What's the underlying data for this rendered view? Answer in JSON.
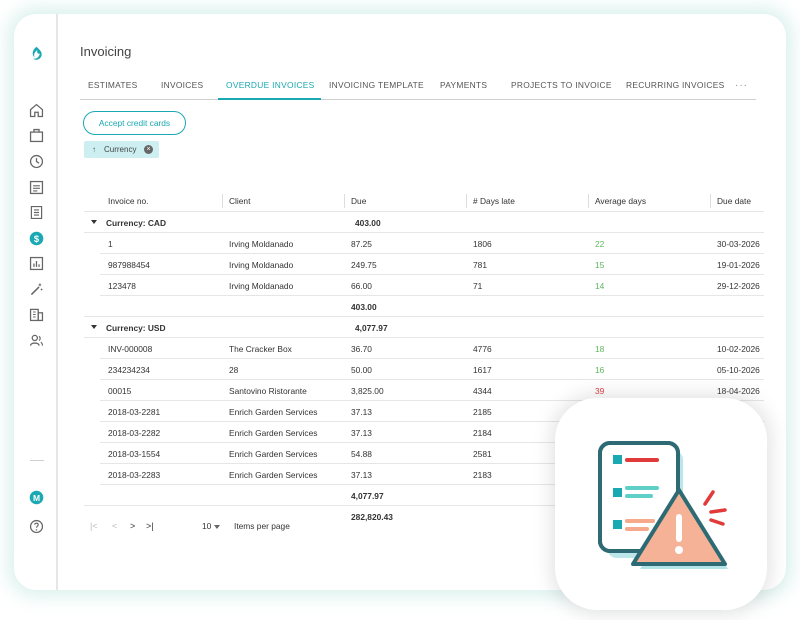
{
  "app": {
    "title": "Invoicing",
    "user_initial": "M"
  },
  "sidebar": {
    "items": [
      "logo-icon",
      "home-icon",
      "briefcase-icon",
      "clock-icon",
      "list-icon",
      "receipt-icon",
      "dollar-icon",
      "chart-icon",
      "wand-icon",
      "building-icon",
      "people-icon"
    ]
  },
  "tabs": [
    "ESTIMATES",
    "INVOICES",
    "OVERDUE INVOICES",
    "INVOICING TEMPLATE",
    "PAYMENTS",
    "PROJECTS TO INVOICE",
    "RECURRING INVOICES"
  ],
  "active_tab": "OVERDUE INVOICES",
  "more_label": "···",
  "accept_button": "Accept credit cards",
  "group_chip": {
    "arrow": "↑",
    "label": "Currency",
    "close": "×"
  },
  "columns": [
    "Invoice no.",
    "Client",
    "Due",
    "# Days late",
    "Average days",
    "Due date"
  ],
  "groups": [
    {
      "label": "Currency: CAD",
      "header_total": "403.00",
      "rows": [
        {
          "invoice": "1",
          "client": "Irving Moldanado",
          "due": "87.25",
          "days_late": "1806",
          "avg_days": "22",
          "avg_color": "green",
          "due_date": "30-03-2026"
        },
        {
          "invoice": "987988454",
          "client": "Irving Moldanado",
          "due": "249.75",
          "days_late": "781",
          "avg_days": "15",
          "avg_color": "green",
          "due_date": "19-01-2026"
        },
        {
          "invoice": "123478",
          "client": "Irving Moldanado",
          "due": "66.00",
          "days_late": "71",
          "avg_days": "14",
          "avg_color": "green",
          "due_date": "29-12-2026"
        }
      ],
      "footer_total": "403.00"
    },
    {
      "label": "Currency: USD",
      "header_total": "4,077.97",
      "rows": [
        {
          "invoice": "INV-000008",
          "client": "The Cracker Box",
          "due": "36.70",
          "days_late": "4776",
          "avg_days": "18",
          "avg_color": "green",
          "due_date": "10-02-2026"
        },
        {
          "invoice": "234234234",
          "client": "28",
          "due": "50.00",
          "days_late": "1617",
          "avg_days": "16",
          "avg_color": "green",
          "due_date": "05-10-2026"
        },
        {
          "invoice": "00015",
          "client": "Santovino Ristorante",
          "due": "3,825.00",
          "days_late": "4344",
          "avg_days": "39",
          "avg_color": "red",
          "due_date": "18-04-2026"
        },
        {
          "invoice": "2018-03-2281",
          "client": "Enrich Garden Services",
          "due": "37.13",
          "days_late": "2185",
          "avg_days": "",
          "avg_color": "",
          "due_date": ""
        },
        {
          "invoice": "2018-03-2282",
          "client": "Enrich Garden Services",
          "due": "37.13",
          "days_late": "2184",
          "avg_days": "",
          "avg_color": "",
          "due_date": ""
        },
        {
          "invoice": "2018-03-1554",
          "client": "Enrich Garden Services",
          "due": "54.88",
          "days_late": "2581",
          "avg_days": "",
          "avg_color": "",
          "due_date": ""
        },
        {
          "invoice": "2018-03-2283",
          "client": "Enrich Garden Services",
          "due": "37.13",
          "days_late": "2183",
          "avg_days": "",
          "avg_color": "",
          "due_date": ""
        }
      ],
      "footer_total": "4,077.97"
    }
  ],
  "grand_total": "282,820.43",
  "pagination": {
    "first": "|<",
    "prev": "<",
    "next": ">",
    "last": ">|",
    "per_page": "10",
    "per_page_label": "Items per page"
  },
  "colors": {
    "accent": "#1aa8b2",
    "green": "#5cb85c",
    "red": "#e03a3a"
  }
}
